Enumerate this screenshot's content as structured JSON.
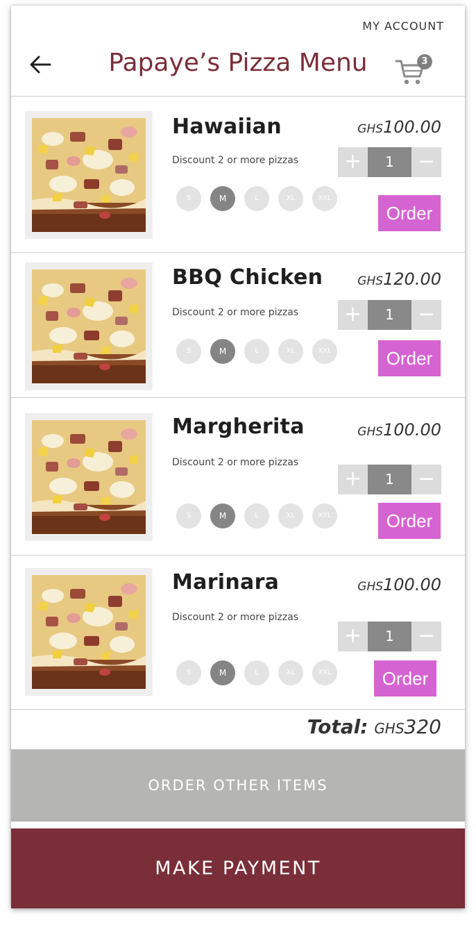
{
  "header": {
    "account_link": "MY ACCOUNT",
    "title": "Papaye’s Pizza Menu",
    "cart_count": "3"
  },
  "items": [
    {
      "name": "Hawaiian",
      "currency": "GHS",
      "amount": "100.00",
      "discount": "Discount 2 or more pizzas",
      "qty": "1",
      "order_label": "Order"
    },
    {
      "name": "BBQ Chicken",
      "currency": "GHS",
      "amount": "120.00",
      "discount": "Discount 2 or more pizzas",
      "qty": "1",
      "order_label": "Order"
    },
    {
      "name": "Margherita",
      "currency": "GHS",
      "amount": "100.00",
      "discount": "Discount 2 or more pizzas",
      "qty": "1",
      "order_label": "Order"
    },
    {
      "name": "Marinara",
      "currency": "GHS",
      "amount": "100.00",
      "discount": "Discount 2 or more pizzas",
      "qty": "1",
      "order_label": "Order"
    }
  ],
  "sizes": [
    "S",
    "M",
    "L",
    "XL",
    "XXL"
  ],
  "selected_size": "M",
  "stepper": {
    "plus": "+",
    "minus": "−"
  },
  "footer": {
    "total_label": "Total:",
    "total_currency": "GHS",
    "total_amount": "320",
    "other_items_button": "ORDER OTHER ITEMS",
    "payment_button": "MAKE PAYMENT"
  },
  "colors": {
    "brand": "#7a2e38",
    "order_button": "#d663d2",
    "secondary_button": "#b5b5b3",
    "size_active": "#858585",
    "size_inactive": "#e3e3e3"
  },
  "icons": {
    "back": "arrow-left-icon",
    "cart": "shopping-cart-icon",
    "item_image": "pizza-image"
  }
}
